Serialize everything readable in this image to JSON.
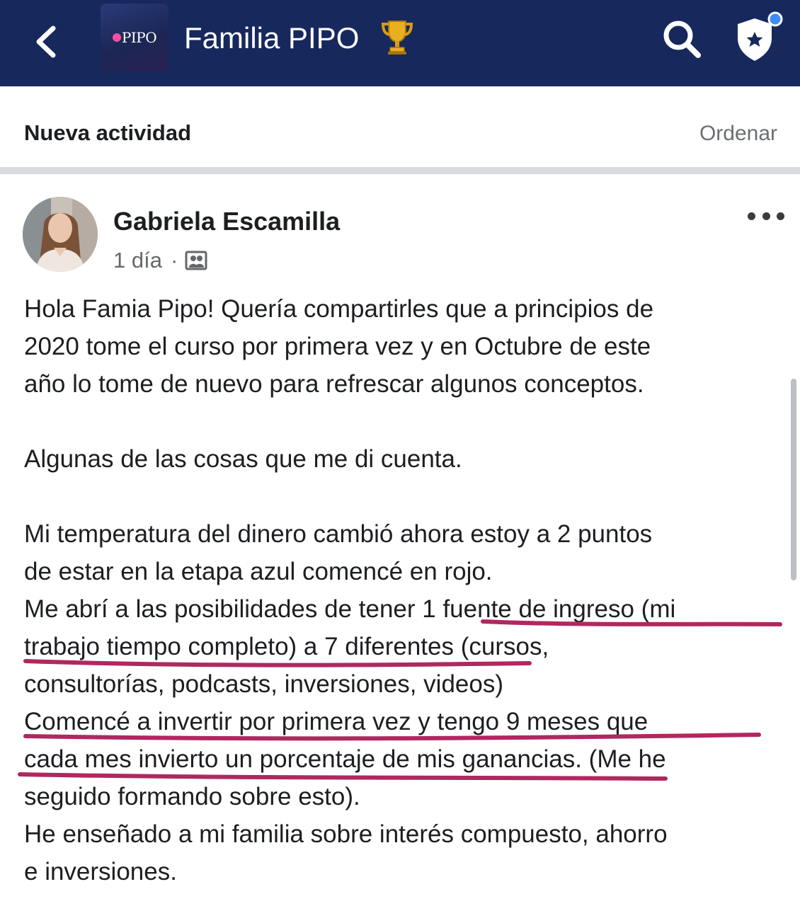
{
  "header": {
    "back_icon": "chevron-left-icon",
    "group_logo_text": "PIPO",
    "group_name": "Familia PIPO",
    "trophy_icon": "trophy-icon",
    "search_icon": "search-icon",
    "badge_icon": "shield-star-icon",
    "colors": {
      "bar": "#17285c",
      "notification_dot": "#3b8cff"
    }
  },
  "subheader": {
    "title": "Nueva actividad",
    "sort_label": "Ordenar"
  },
  "post": {
    "author": "Gabriela Escamilla",
    "time": "1 día",
    "separator": "·",
    "audience_icon": "group-members-icon",
    "more_icon": "more-horizontal-icon",
    "paragraphs": [
      "Hola Famia Pipo! Quería compartirles que a principios de",
      "2020 tome el curso por primera vez y en Octubre de este",
      "año lo tome de nuevo para refrescar algunos conceptos.",
      "",
      "Algunas de las cosas que me di cuenta.",
      "",
      "Mi temperatura del dinero cambió ahora estoy a 2 puntos",
      "de estar en la etapa azul comencé en rojo.",
      "Me abrí a las posibilidades de tener 1 fuente de ingreso (mi",
      "trabajo tiempo completo) a 7 diferentes (cursos,",
      "consultorías, podcasts, inversiones, videos)",
      "Comencé a invertir por primera vez y tengo 9 meses que",
      "cada mes invierto un porcentaje de mis ganancias. (Me he",
      "seguido formando sobre esto).",
      "He enseñado a mi familia sobre interés compuesto, ahorro",
      "e inversiones."
    ],
    "underline_color": "#b0285f"
  }
}
